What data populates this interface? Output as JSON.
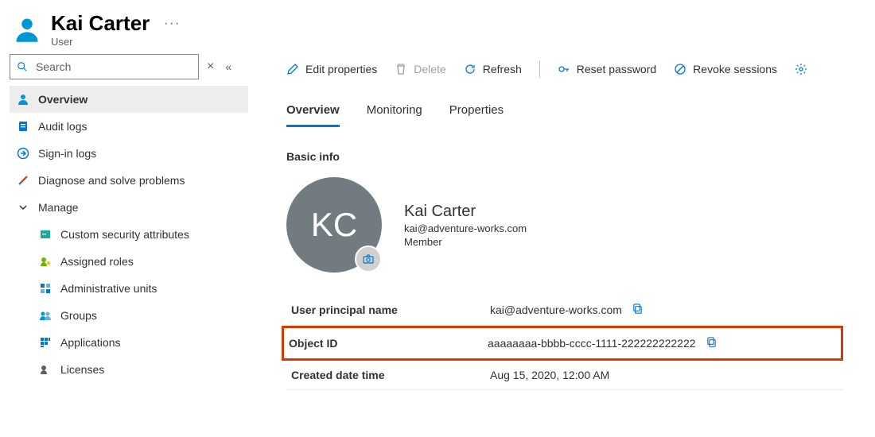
{
  "header": {
    "title": "Kai Carter",
    "subtitle": "User"
  },
  "sidebar": {
    "search_placeholder": "Search",
    "items": [
      {
        "label": "Overview"
      },
      {
        "label": "Audit logs"
      },
      {
        "label": "Sign-in logs"
      },
      {
        "label": "Diagnose and solve problems"
      },
      {
        "label": "Manage"
      },
      {
        "label": "Custom security attributes"
      },
      {
        "label": "Assigned roles"
      },
      {
        "label": "Administrative units"
      },
      {
        "label": "Groups"
      },
      {
        "label": "Applications"
      },
      {
        "label": "Licenses"
      }
    ]
  },
  "toolbar": {
    "edit": "Edit properties",
    "delete": "Delete",
    "refresh": "Refresh",
    "reset": "Reset password",
    "revoke": "Revoke sessions"
  },
  "tabs": {
    "overview": "Overview",
    "monitoring": "Monitoring",
    "properties": "Properties"
  },
  "section": {
    "basic_info": "Basic info"
  },
  "basic": {
    "initials": "KC",
    "name": "Kai Carter",
    "email": "kai@adventure-works.com",
    "member": "Member"
  },
  "props": {
    "upn_label": "User principal name",
    "upn_value": "kai@adventure-works.com",
    "object_id_label": "Object ID",
    "object_id_value": "aaaaaaaa-bbbb-cccc-1111-222222222222",
    "created_label": "Created date time",
    "created_value": "Aug 15, 2020, 12:00 AM"
  }
}
